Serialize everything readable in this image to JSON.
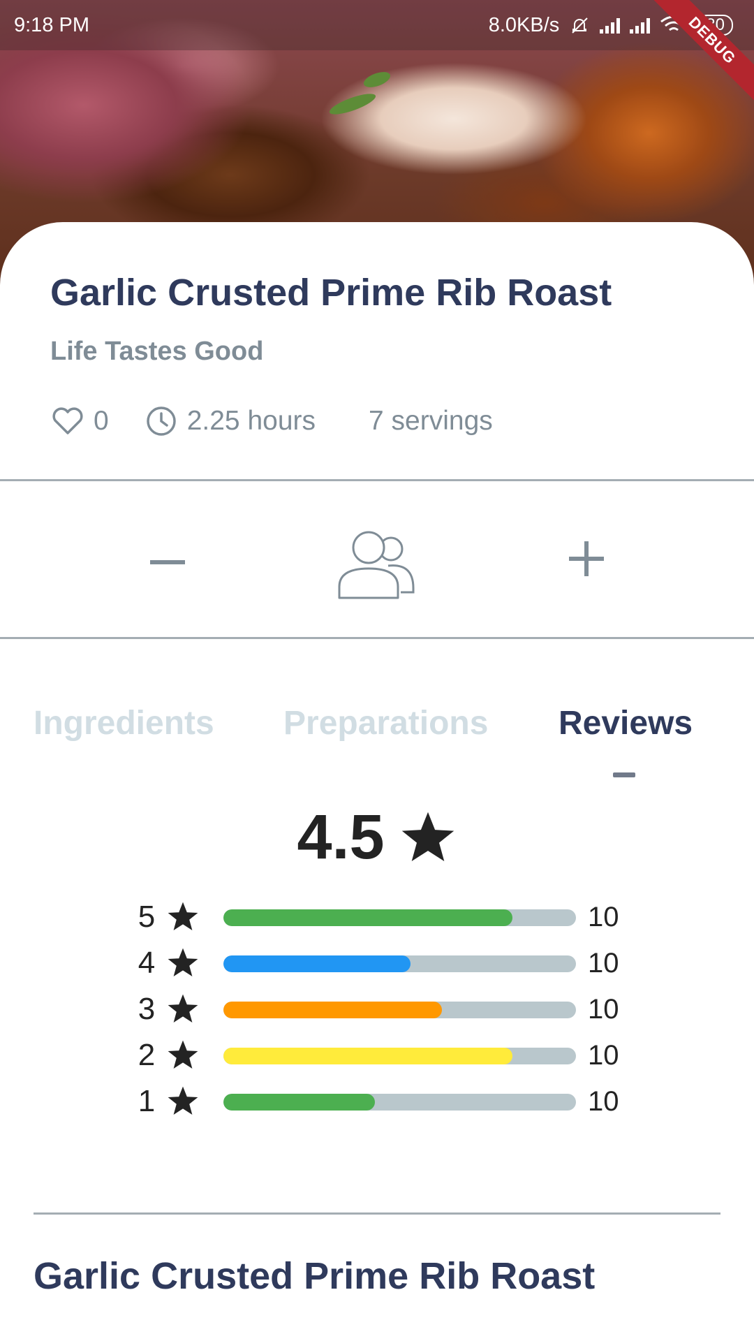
{
  "status_bar": {
    "time": "9:18 PM",
    "net_speed": "8.0KB/s",
    "battery": "80",
    "debug_banner": "DEBUG"
  },
  "recipe": {
    "title": "Garlic Crusted Prime Rib Roast",
    "subtitle": "Life Tastes Good",
    "likes": "0",
    "duration": "2.25 hours",
    "servings": "7 servings"
  },
  "stepper": {
    "minus_icon": "minus-icon",
    "people_icon": "people-icon",
    "plus_icon": "plus-icon"
  },
  "tabs": {
    "items": [
      {
        "label": "Ingredients",
        "active": false
      },
      {
        "label": "Preparations",
        "active": false
      },
      {
        "label": "Reviews",
        "active": true
      }
    ]
  },
  "reviews": {
    "average": "4.5",
    "breakdown": [
      {
        "stars": "5",
        "count": "10",
        "fill_fraction": 0.82,
        "color": "#4caf50"
      },
      {
        "stars": "4",
        "count": "10",
        "fill_fraction": 0.53,
        "color": "#2196f3"
      },
      {
        "stars": "3",
        "count": "10",
        "fill_fraction": 0.62,
        "color": "#ff9800"
      },
      {
        "stars": "2",
        "count": "10",
        "fill_fraction": 0.82,
        "color": "#ffeb3b"
      },
      {
        "stars": "1",
        "count": "10",
        "fill_fraction": 0.43,
        "color": "#4caf50"
      }
    ]
  },
  "review_item": {
    "title": "Garlic Crusted Prime Rib Roast"
  },
  "colors": {
    "title": "#2f3a5c",
    "muted": "#7f8c96",
    "tab_inactive": "#d1dde3",
    "debug": "#b3262e"
  }
}
